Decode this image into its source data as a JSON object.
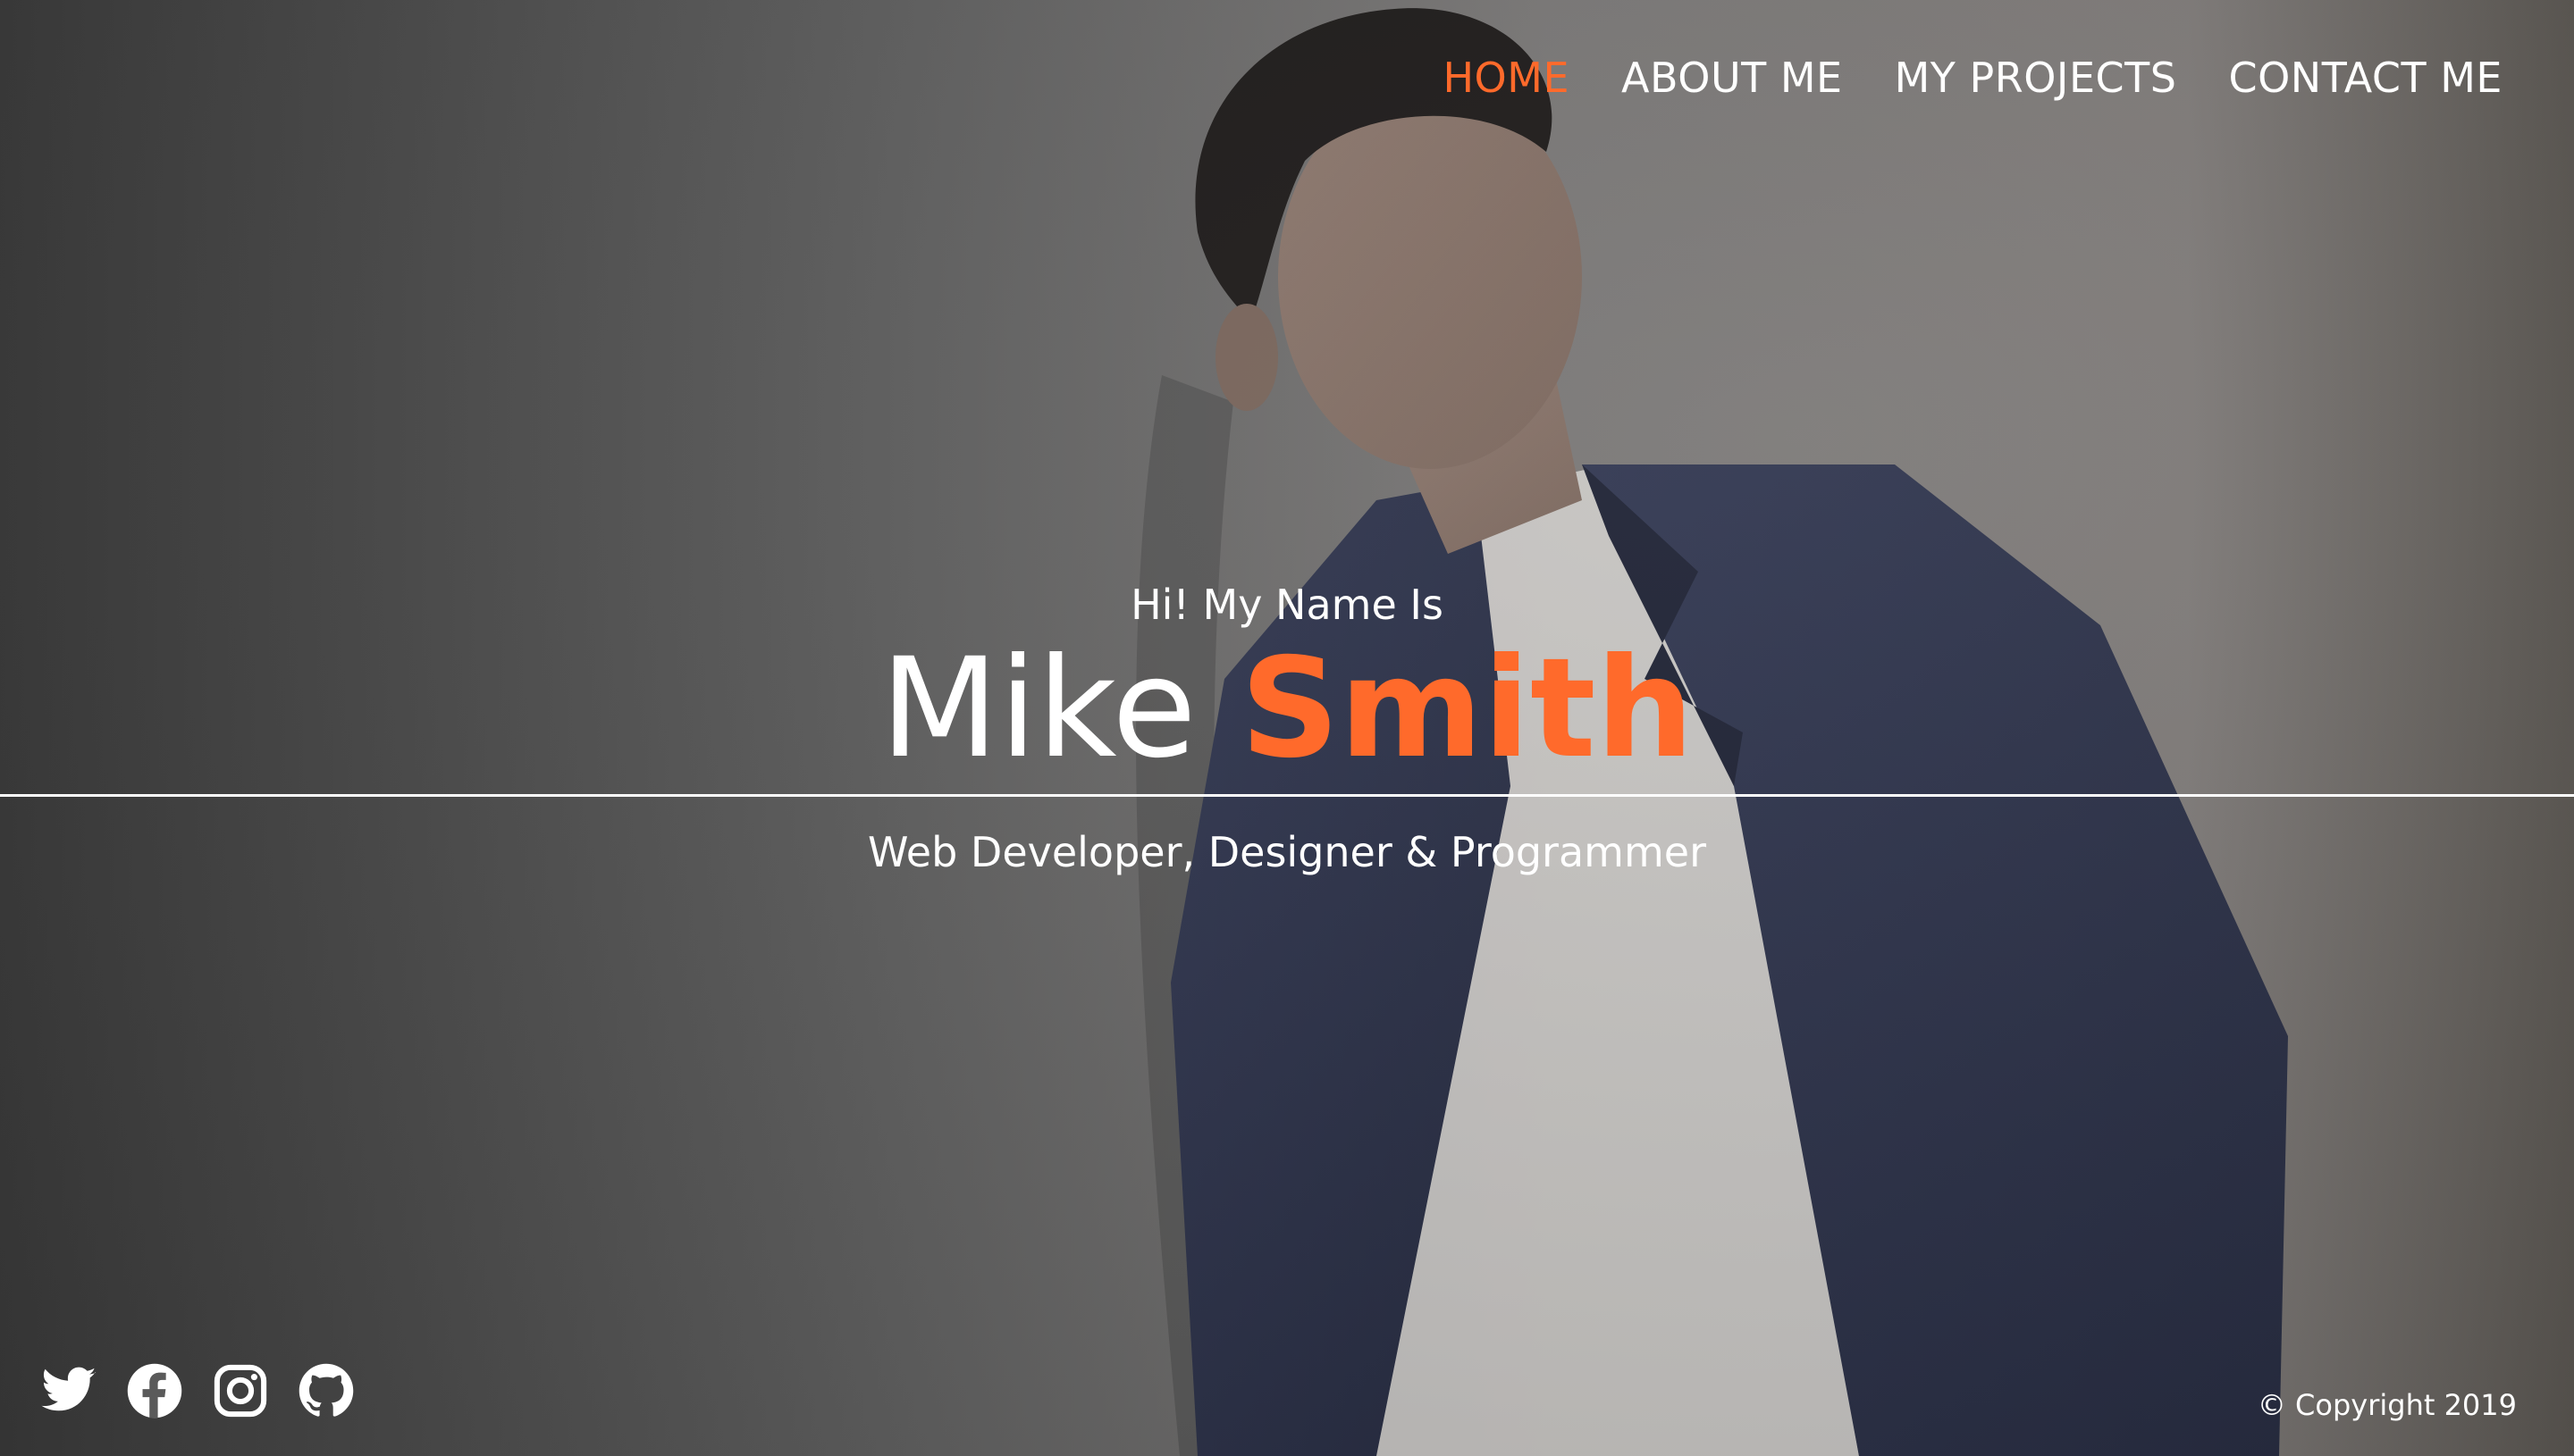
{
  "nav": {
    "items": [
      {
        "label": "HOME",
        "active": true
      },
      {
        "label": "ABOUT ME",
        "active": false
      },
      {
        "label": "MY PROJECTS",
        "active": false
      },
      {
        "label": "CONTACT ME",
        "active": false
      }
    ]
  },
  "hero": {
    "greeting": "Hi! My Name Is",
    "first_name": "Mike",
    "last_name": "Smith",
    "subtitle": "Web Developer, Designer & Programmer"
  },
  "social": {
    "icons": [
      "twitter-icon",
      "facebook-icon",
      "instagram-icon",
      "github-icon"
    ]
  },
  "footer": {
    "copyright": "© Copyright 2019"
  },
  "colors": {
    "accent": "#ff6a2b",
    "text": "#ffffff"
  }
}
